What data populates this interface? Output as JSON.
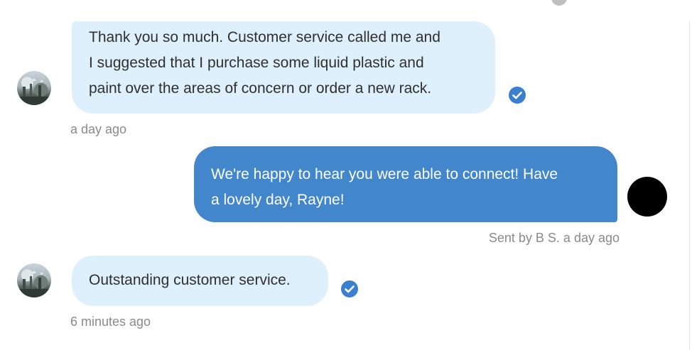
{
  "messages": [
    {
      "direction": "incoming",
      "text_lines": [
        "Thank you so much. Customer service called me and",
        "I suggested that I purchase some liquid plastic and",
        "paint over the areas of concern or order a new rack."
      ],
      "timestamp": "a day ago",
      "verified_icon": "check-circle-icon"
    },
    {
      "direction": "outgoing",
      "text_lines": [
        "We're happy to hear you were able to connect! Have",
        "a lovely day, Rayne!"
      ],
      "meta": "Sent by B S. a day ago"
    },
    {
      "direction": "incoming",
      "text_lines": [
        "Outstanding customer service."
      ],
      "timestamp": "6 minutes ago",
      "verified_icon": "check-circle-icon"
    }
  ],
  "colors": {
    "incoming_bubble": "#dff0fd",
    "outgoing_bubble": "#4286cc",
    "check_badge": "#3a7fd0",
    "meta_text": "#8a8a8a"
  }
}
